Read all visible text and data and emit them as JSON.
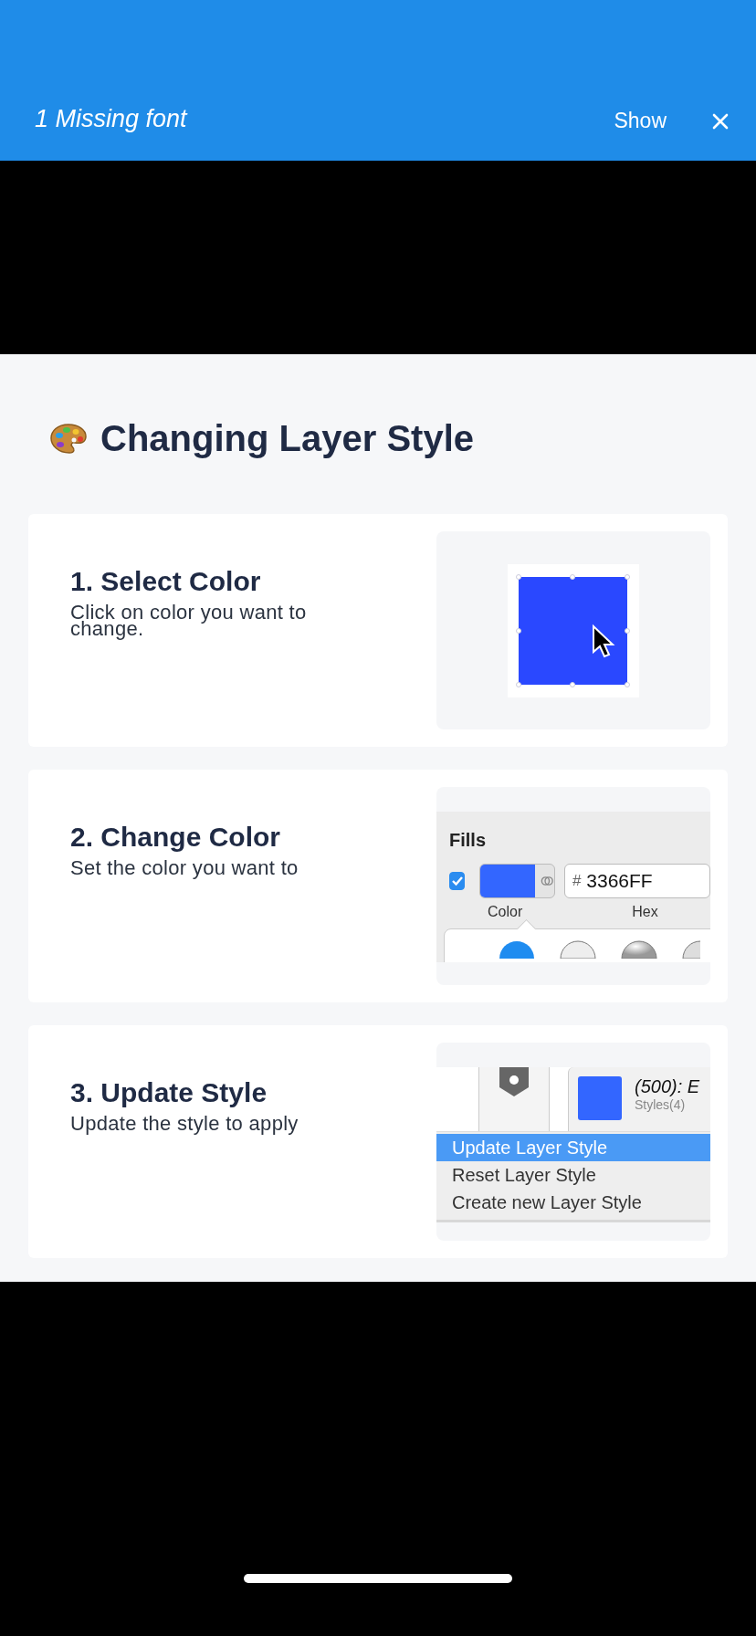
{
  "banner": {
    "message": "1 Missing font",
    "action": "Show"
  },
  "heading": {
    "title": "Changing Layer Style"
  },
  "steps": [
    {
      "title": "1. Select Color",
      "description": "Click on color you want to change.",
      "illustration": {
        "kind": "swatch"
      }
    },
    {
      "title": "2. Change Color",
      "description": "Set the color you want to",
      "illustration": {
        "kind": "fills",
        "heading": "Fills",
        "checked": true,
        "hex_prefix": "#",
        "hex": "3366FF",
        "color_label": "Color",
        "hex_label": "Hex"
      }
    },
    {
      "title": "3. Update Style",
      "description": "Update the style to apply",
      "illustration": {
        "kind": "menu",
        "style_name": "(500): E",
        "style_group": "Styles(4)",
        "items": [
          {
            "label": "Update Layer Style",
            "selected": true
          },
          {
            "label": "Reset Layer Style",
            "selected": false
          },
          {
            "label": "Create new Layer Style",
            "selected": false
          }
        ]
      }
    }
  ]
}
